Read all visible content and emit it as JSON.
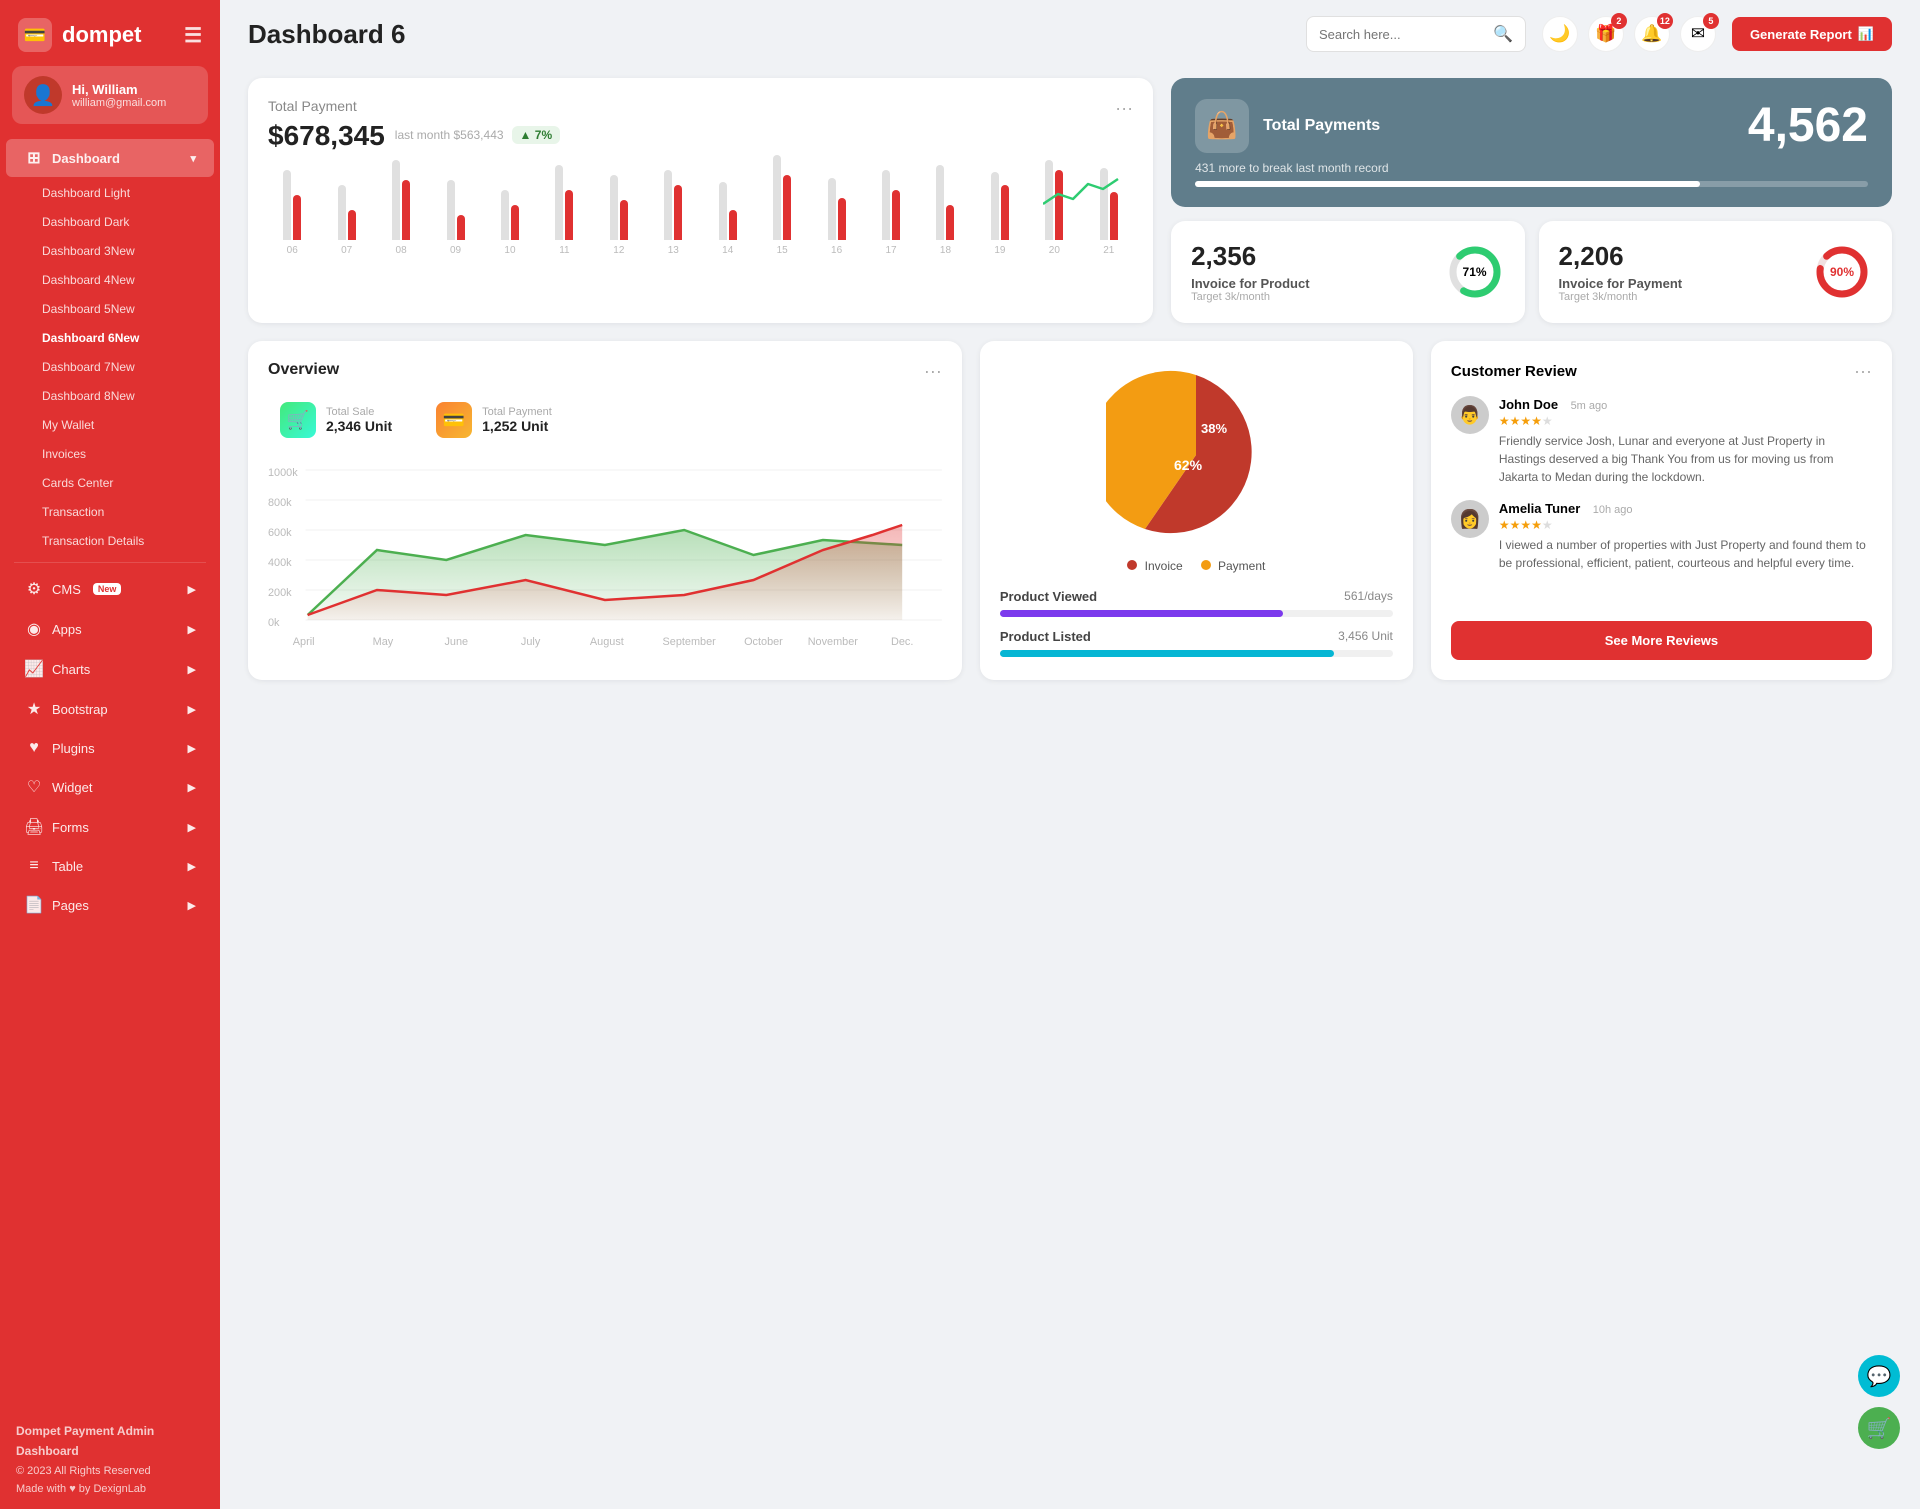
{
  "sidebar": {
    "logo": "dompet",
    "logo_icon": "💳",
    "user": {
      "name": "Hi, William",
      "email": "william@gmail.com",
      "avatar": "👤"
    },
    "menu": [
      {
        "id": "dashboard",
        "label": "Dashboard",
        "icon": "⊞",
        "has_arrow": true,
        "active": true
      },
      {
        "id": "dashboard-light",
        "label": "Dashboard Light",
        "is_sub": true
      },
      {
        "id": "dashboard-dark",
        "label": "Dashboard Dark",
        "is_sub": true
      },
      {
        "id": "dashboard-3",
        "label": "Dashboard 3",
        "is_sub": true,
        "badge": "New"
      },
      {
        "id": "dashboard-4",
        "label": "Dashboard 4",
        "is_sub": true,
        "badge": "New"
      },
      {
        "id": "dashboard-5",
        "label": "Dashboard 5",
        "is_sub": true,
        "badge": "New"
      },
      {
        "id": "dashboard-6",
        "label": "Dashboard 6",
        "is_sub": true,
        "badge": "New",
        "active_sub": true
      },
      {
        "id": "dashboard-7",
        "label": "Dashboard 7",
        "is_sub": true,
        "badge": "New"
      },
      {
        "id": "dashboard-8",
        "label": "Dashboard 8",
        "is_sub": true,
        "badge": "New"
      },
      {
        "id": "my-wallet",
        "label": "My Wallet",
        "is_sub": true
      },
      {
        "id": "invoices",
        "label": "Invoices",
        "is_sub": true
      },
      {
        "id": "cards-center",
        "label": "Cards Center",
        "is_sub": true
      },
      {
        "id": "transaction",
        "label": "Transaction",
        "is_sub": true
      },
      {
        "id": "transaction-details",
        "label": "Transaction Details",
        "is_sub": true
      }
    ],
    "bottom_menu": [
      {
        "id": "cms",
        "label": "CMS",
        "icon": "⚙",
        "has_arrow": true,
        "badge": "New"
      },
      {
        "id": "apps",
        "label": "Apps",
        "icon": "◉",
        "has_arrow": true
      },
      {
        "id": "charts",
        "label": "Charts",
        "icon": "📈",
        "has_arrow": true
      },
      {
        "id": "bootstrap",
        "label": "Bootstrap",
        "icon": "★",
        "has_arrow": true
      },
      {
        "id": "plugins",
        "label": "Plugins",
        "icon": "♥",
        "has_arrow": true
      },
      {
        "id": "widget",
        "label": "Widget",
        "icon": "♥",
        "has_arrow": true
      },
      {
        "id": "forms",
        "label": "Forms",
        "icon": "🖨",
        "has_arrow": true
      },
      {
        "id": "table",
        "label": "Table",
        "icon": "≡",
        "has_arrow": true
      },
      {
        "id": "pages",
        "label": "Pages",
        "icon": "📄",
        "has_arrow": true
      }
    ],
    "footer": {
      "brand": "Dompet Payment Admin Dashboard",
      "copy": "© 2023 All Rights Reserved",
      "made": "Made with ♥ by DexignLab"
    }
  },
  "header": {
    "title": "Dashboard 6",
    "search_placeholder": "Search here...",
    "icons": [
      {
        "id": "moon",
        "symbol": "🌙",
        "badge": null
      },
      {
        "id": "gift",
        "symbol": "🎁",
        "badge": "2"
      },
      {
        "id": "bell",
        "symbol": "🔔",
        "badge": "12"
      },
      {
        "id": "message",
        "symbol": "✉",
        "badge": "5"
      }
    ],
    "generate_btn": "Generate Report"
  },
  "total_payment_card": {
    "title": "Total Payment",
    "amount": "$678,345",
    "last_month_label": "last month $563,443",
    "trend_pct": "7%",
    "bars": [
      {
        "label": "06",
        "gray": 70,
        "red": 45
      },
      {
        "label": "07",
        "gray": 55,
        "red": 30
      },
      {
        "label": "08",
        "gray": 80,
        "red": 60
      },
      {
        "label": "09",
        "gray": 60,
        "red": 25
      },
      {
        "label": "10",
        "gray": 50,
        "red": 35
      },
      {
        "label": "11",
        "gray": 75,
        "red": 50
      },
      {
        "label": "12",
        "gray": 65,
        "red": 40
      },
      {
        "label": "13",
        "gray": 70,
        "red": 55
      },
      {
        "label": "14",
        "gray": 58,
        "red": 30
      },
      {
        "label": "15",
        "gray": 85,
        "red": 65
      },
      {
        "label": "16",
        "gray": 62,
        "red": 42
      },
      {
        "label": "17",
        "gray": 70,
        "red": 50
      },
      {
        "label": "18",
        "gray": 75,
        "red": 35
      },
      {
        "label": "19",
        "gray": 68,
        "red": 55
      },
      {
        "label": "20",
        "gray": 80,
        "red": 70
      },
      {
        "label": "21",
        "gray": 72,
        "red": 48
      }
    ]
  },
  "total_payments_blue": {
    "label": "Total Payments",
    "number": "4,562",
    "sub": "431 more to break last month record",
    "progress": 75
  },
  "invoice_product": {
    "number": "2,356",
    "label": "Invoice for Product",
    "target": "Target 3k/month",
    "pct": 71,
    "color": "#2ecc71"
  },
  "invoice_payment": {
    "number": "2,206",
    "label": "Invoice for Payment",
    "target": "Target 3k/month",
    "pct": 90,
    "color": "#e03131"
  },
  "overview_card": {
    "title": "Overview",
    "total_sale": {
      "label": "Total Sale",
      "value": "2,346 Unit"
    },
    "total_payment": {
      "label": "Total Payment",
      "value": "1,252 Unit"
    },
    "months": [
      "April",
      "May",
      "June",
      "July",
      "August",
      "September",
      "October",
      "November",
      "Dec."
    ],
    "y_labels": [
      "1000k",
      "800k",
      "600k",
      "400k",
      "200k",
      "0k"
    ]
  },
  "pie_chart": {
    "invoice_pct": 62,
    "payment_pct": 38,
    "invoice_color": "#c0392b",
    "payment_color": "#f39c12",
    "legend": [
      {
        "label": "Invoice",
        "color": "#c0392b"
      },
      {
        "label": "Payment",
        "color": "#f39c12"
      }
    ]
  },
  "product_stats": {
    "items": [
      {
        "label": "Product Viewed",
        "value": "561/days",
        "pct": 72,
        "color": "purple"
      },
      {
        "label": "Product Listed",
        "value": "3,456 Unit",
        "pct": 85,
        "color": "teal"
      }
    ]
  },
  "customer_review": {
    "title": "Customer Review",
    "reviews": [
      {
        "name": "John Doe",
        "time": "5m ago",
        "stars": 4,
        "text": "Friendly service Josh, Lunar and everyone at Just Property in Hastings deserved a big Thank You from us for moving us from Jakarta to Medan during the lockdown.",
        "avatar": "👨"
      },
      {
        "name": "Amelia Tuner",
        "time": "10h ago",
        "stars": 4,
        "text": "I viewed a number of properties with Just Property and found them to be professional, efficient, patient, courteous and helpful every time.",
        "avatar": "👩"
      }
    ],
    "see_more_btn": "See More Reviews"
  }
}
